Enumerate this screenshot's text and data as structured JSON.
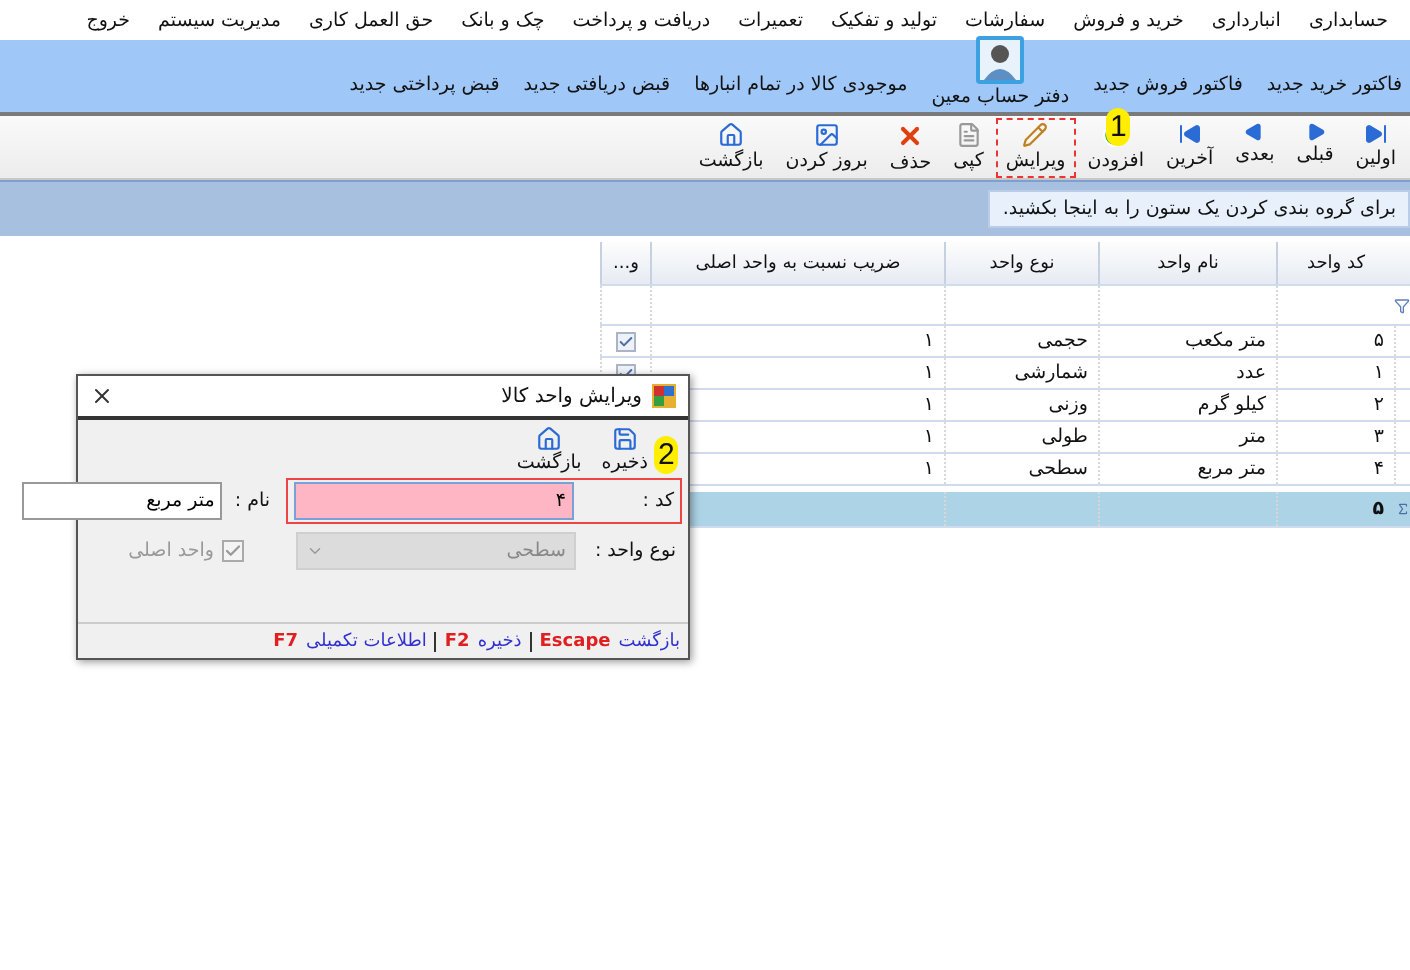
{
  "menu": [
    "حسابداری",
    "انبارداری",
    "خرید و فروش",
    "سفارشات",
    "تولید و تفکیک",
    "تعمیرات",
    "دریافت و پرداخت",
    "چک و بانک",
    "حق العمل کاری",
    "مدیریت سیستم",
    "خروج"
  ],
  "quick_links": [
    {
      "kind": "text",
      "label": "فاکتور خرید جدید"
    },
    {
      "kind": "text",
      "label": "فاکتور فروش جدید"
    },
    {
      "kind": "avatar",
      "label": "دفتر حساب معین"
    },
    {
      "kind": "text",
      "label": "موجودی کالا در تمام انبارها"
    },
    {
      "kind": "text",
      "label": "قبض دریافتی جدید"
    },
    {
      "kind": "text",
      "label": "قبض پرداختی جدید"
    }
  ],
  "toolbar": [
    {
      "label": "اولین",
      "selected": false
    },
    {
      "label": "قبلی",
      "selected": false
    },
    {
      "label": "بعدی",
      "selected": false
    },
    {
      "label": "آخرین",
      "selected": false
    },
    {
      "label": "افزودن",
      "selected": false
    },
    {
      "label": "ویرایش",
      "selected": true
    },
    {
      "label": "کپی",
      "selected": false
    },
    {
      "label": "حذف",
      "selected": false
    },
    {
      "label": "بروز کردن",
      "selected": false
    },
    {
      "label": "بازگشت",
      "selected": false
    }
  ],
  "group_hint": "برای گروه بندی کردن یک ستون را به اینجا بکشید.",
  "grid": {
    "columns": [
      "کد واحد",
      "نام واحد",
      "نوع واحد",
      "ضریب نسبت به واحد اصلی",
      "و..."
    ],
    "rows": [
      {
        "cells": [
          "۵",
          "متر مکعب",
          "حجمی",
          "۱"
        ],
        "checked": true
      },
      {
        "cells": [
          "۱",
          "عدد",
          "شمارشی",
          "۱"
        ],
        "checked": true
      },
      {
        "cells": [
          "۲",
          "کیلو گرم",
          "وزنی",
          "۱"
        ]
      },
      {
        "cells": [
          "۳",
          "متر",
          "طولی",
          "۱"
        ]
      },
      {
        "cells": [
          "۴",
          "متر مربع",
          "سطحی",
          "۱"
        ]
      }
    ],
    "footer": "۵"
  },
  "dialog": {
    "title": "ویرایش واحد کالا",
    "tools": [
      "ذخیره",
      "بازگشت"
    ],
    "code_label": "کد :",
    "code_value": "۴",
    "name_label": "نام :",
    "name_value": "متر مربع",
    "type_label": "نوع واحد :",
    "type_value": "سطحی",
    "main_unit": {
      "label": "واحد اصلی",
      "checked": true,
      "disabled": true
    },
    "shortcuts": [
      {
        "label": "بازگشت",
        "key": "Escape"
      },
      {
        "label": "ذخیره",
        "key": "F2"
      },
      {
        "label": "اطلاعات تکمیلی",
        "key": "F7"
      }
    ]
  },
  "annotations": [
    "1",
    "2"
  ]
}
